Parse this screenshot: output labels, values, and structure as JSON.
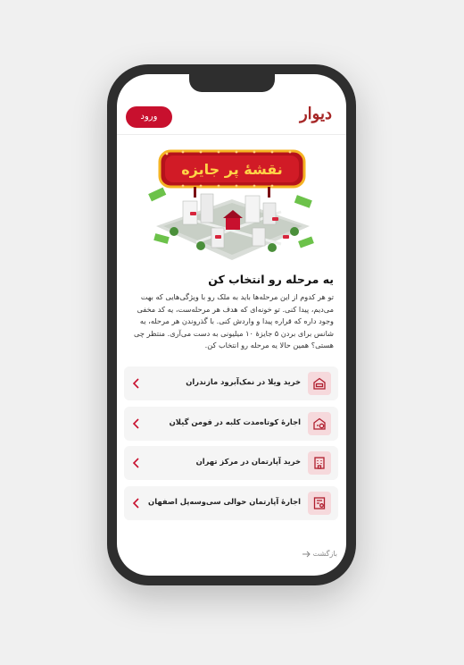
{
  "header": {
    "logo": "دیوار",
    "login_label": "ورود"
  },
  "hero": {
    "banner_text": "نقشهٔ پر جایزه"
  },
  "content": {
    "title": "یه مرحله رو انتخاب کن",
    "description": "تو هر کدوم از این مرحله‌ها باید به ملک رو با ویژگی‌هایی که بهت می‌دیم، پیدا کنی. تو خونه‌ای که هدف هر مرحله‌ست، یه کد مخفی وجود داره که قراره پیدا و واردش کنی. با گذروندن هر مرحله، یه شانس برای بردن ۵ جایزهٔ ۱۰ میلیونی به دست می‌آری. منتظر چی هستی؟ همین حالا یه مرحله رو انتخاب کن."
  },
  "options": [
    {
      "label": "خرید ویلا در نمک‌آبرود مازندران",
      "icon": "villa-icon"
    },
    {
      "label": "اجارهٔ کوتاه‌مدت کلبه در فومن گیلان",
      "icon": "cabin-icon"
    },
    {
      "label": "خرید آپارتمان در مرکز تهران",
      "icon": "apartment-icon"
    },
    {
      "label": "اجارهٔ آپارتمان حوالی سی‌وسه‌پل اصفهان",
      "icon": "building-rent-icon"
    }
  ],
  "footer": {
    "back_label": "بازگشت"
  },
  "colors": {
    "brand": "#a62626",
    "button": "#c8102e",
    "icon_bg": "#f6d9dc",
    "option_bg": "#f5f5f5"
  }
}
